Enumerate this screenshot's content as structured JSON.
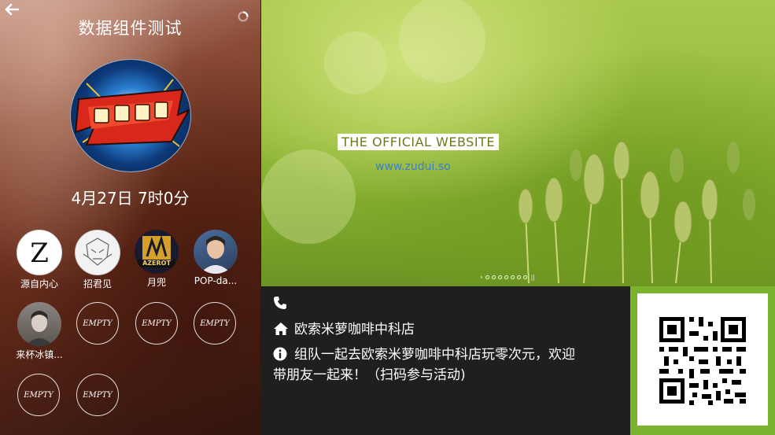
{
  "app": {
    "title": "数据组件测试",
    "date_time": "4月27日 7时0分"
  },
  "members": [
    {
      "name": "源自内心",
      "avatar": "z-letter-avatar"
    },
    {
      "name": "招君见",
      "avatar": "mecha-sketch-avatar"
    },
    {
      "name": "月兜",
      "avatar": "azerot-logo-avatar",
      "badge": "AZEROT"
    },
    {
      "name": "POP-da...",
      "avatar": "photo-avatar"
    },
    {
      "name": "来杯冰镇...",
      "avatar": "photo-avatar"
    }
  ],
  "empty_slots": [
    "EMPTY",
    "EMPTY",
    "EMPTY",
    "EMPTY",
    "EMPTY"
  ],
  "banner": {
    "heading": "THE OFFICIAL WEBSITE",
    "url": "www.zudui.so",
    "slide_count": 7
  },
  "info": {
    "phone": "",
    "shop_name": "欧索米萝咖啡中科店",
    "description_line1": "组队一起去欧索米萝咖啡中科店玩零次元，欢迎",
    "description_line2": "带朋友一起来！（扫码参与活动)"
  },
  "colors": {
    "qr_frame": "#7bb32e",
    "info_bg": "#1f1f1f",
    "banner_url": "#3d7ec7"
  }
}
